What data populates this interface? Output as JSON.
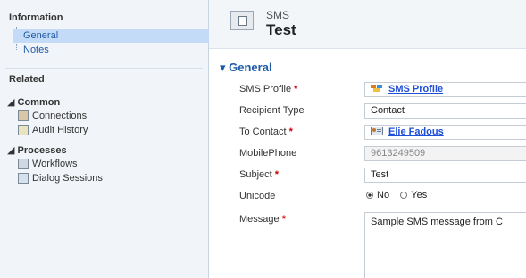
{
  "sidebar": {
    "information_header": "Information",
    "information_items": [
      "General",
      "Notes"
    ],
    "related_header": "Related",
    "common_header": "Common",
    "common_items": [
      "Connections",
      "Audit History"
    ],
    "processes_header": "Processes",
    "processes_items": [
      "Workflows",
      "Dialog Sessions"
    ]
  },
  "header": {
    "entity_type": "SMS",
    "record_name": "Test"
  },
  "form": {
    "section_title": "General",
    "fields": {
      "sms_profile": {
        "label": "SMS Profile",
        "value": "SMS Profile"
      },
      "recipient_type": {
        "label": "Recipient Type",
        "value": "Contact"
      },
      "to_contact": {
        "label": "To Contact",
        "value": "Elie Fadous"
      },
      "mobile_phone": {
        "label": "MobilePhone",
        "value": "9613249509"
      },
      "subject": {
        "label": "Subject",
        "value": "Test"
      },
      "unicode": {
        "label": "Unicode",
        "options": [
          "No",
          "Yes"
        ],
        "selected": "No"
      },
      "message": {
        "label": "Message",
        "value": "Sample SMS message from C"
      }
    },
    "required_marker": "*"
  },
  "colors": {
    "link_blue": "#1f5aa6",
    "required_red": "#d00000",
    "selected_bg": "#c4dbf7"
  }
}
